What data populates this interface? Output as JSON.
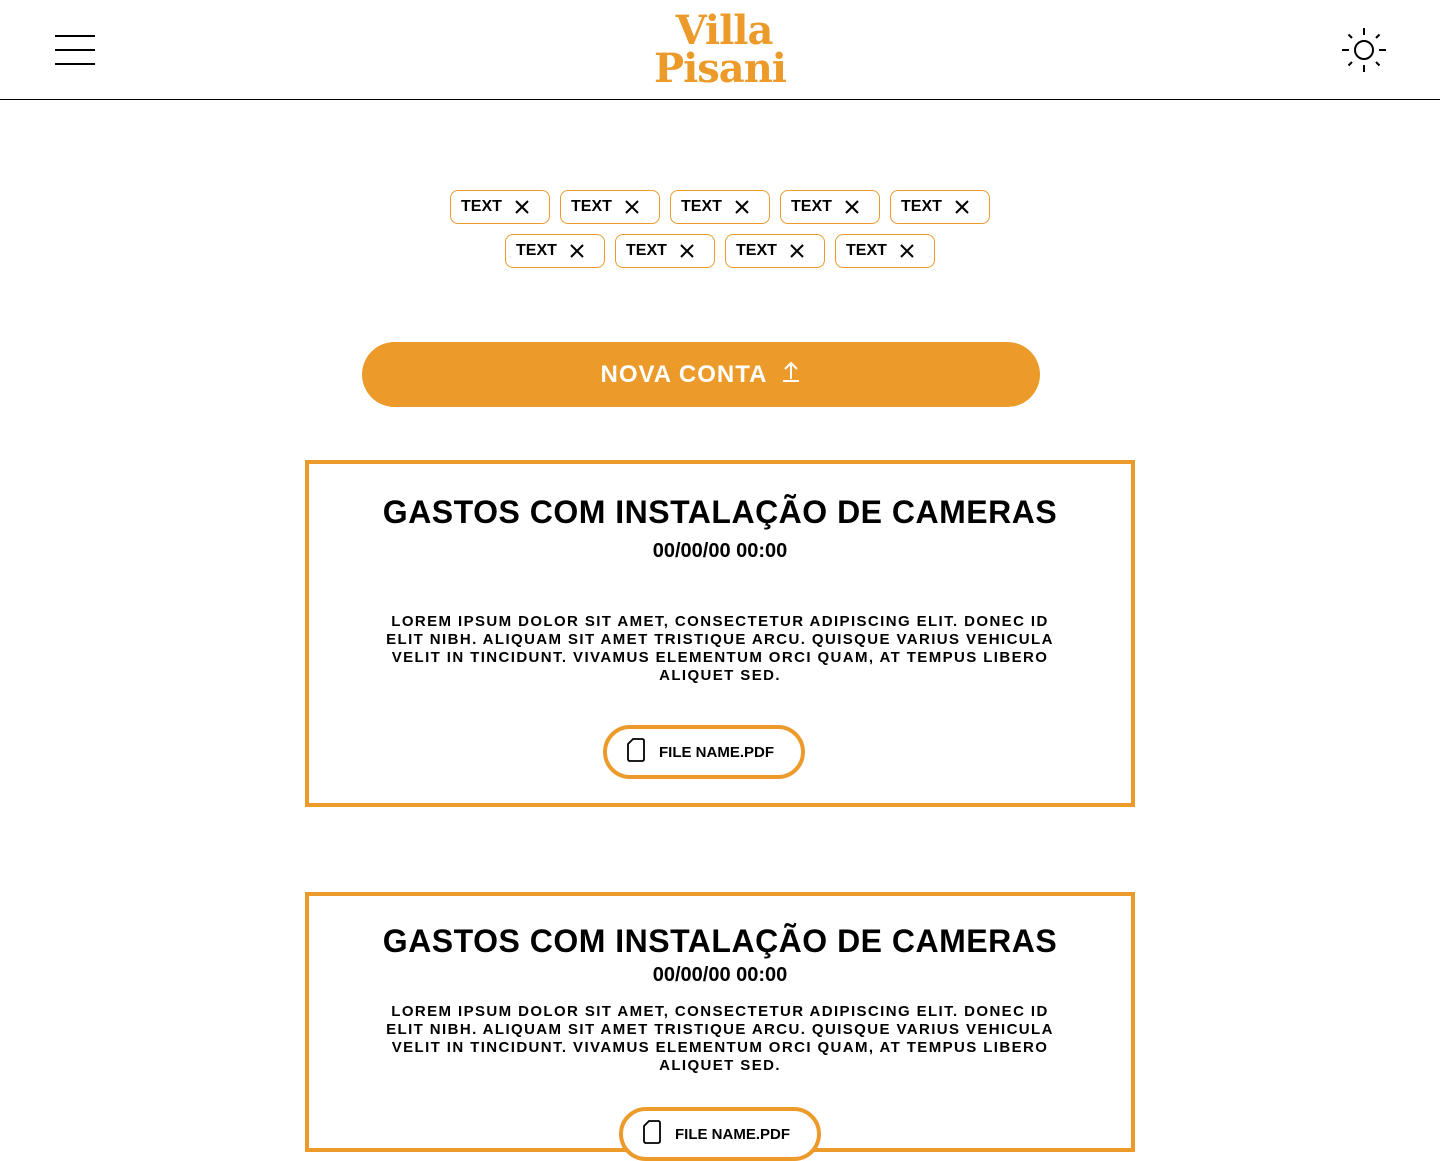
{
  "header": {
    "logo_line1": "Villa",
    "logo_line2": "Pisani",
    "menu_icon": "hamburger-menu-icon",
    "theme_icon": "sun-icon"
  },
  "tags": {
    "row1": [
      "TEXT",
      "TEXT",
      "TEXT",
      "TEXT",
      "TEXT"
    ],
    "row2": [
      "TEXT",
      "TEXT",
      "TEXT",
      "TEXT"
    ],
    "close_icon": "close-icon"
  },
  "primary_action": {
    "label": "NOVA CONTA",
    "icon": "upload-arrow-icon"
  },
  "cards": [
    {
      "title": "GASTOS COM INSTALAÇÃO DE CAMERAS",
      "date": "00/00/00 00:00",
      "body": "LOREM IPSUM DOLOR SIT AMET, CONSECTETUR ADIPISCING ELIT. DONEC ID ELIT NIBH. ALIQUAM SIT AMET TRISTIQUE ARCU. QUISQUE VARIUS VEHICULA VELIT IN TINCIDUNT. VIVAMUS ELEMENTUM ORCI QUAM, AT TEMPUS LIBERO ALIQUET SED.",
      "file_name": "FILE NAME.PDF",
      "file_icon": "file-icon"
    },
    {
      "title": "GASTOS COM INSTALAÇÃO DE CAMERAS",
      "date": "00/00/00 00:00",
      "body": "LOREM IPSUM DOLOR SIT AMET, CONSECTETUR ADIPISCING ELIT. DONEC ID ELIT NIBH. ALIQUAM SIT AMET TRISTIQUE ARCU. QUISQUE VARIUS VEHICULA VELIT IN TINCIDUNT. VIVAMUS ELEMENTUM ORCI QUAM, AT TEMPUS LIBERO ALIQUET SED.",
      "file_name": "FILE NAME.PDF",
      "file_icon": "file-icon"
    }
  ],
  "colors": {
    "accent": "#EC9B2B",
    "text": "#000000",
    "background": "#FFFFFF"
  }
}
